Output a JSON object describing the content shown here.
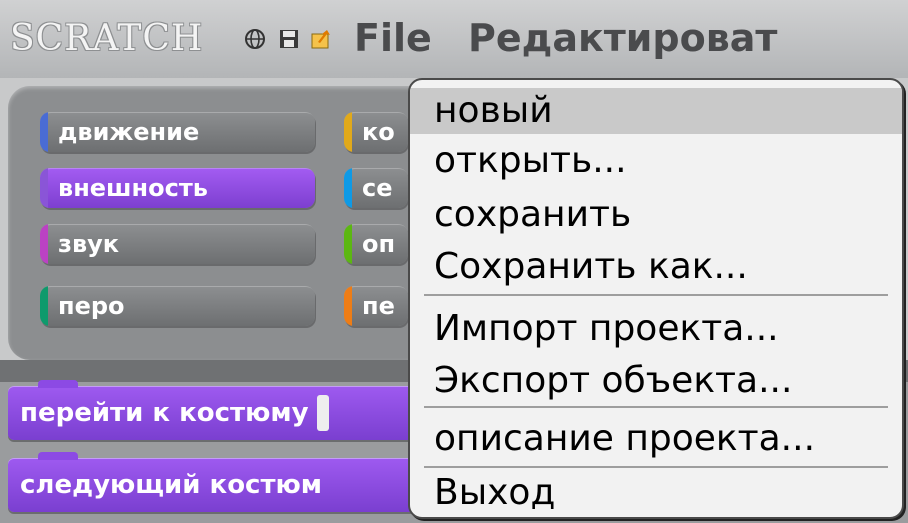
{
  "app": {
    "logo_text": "SCRATCH"
  },
  "topbar": {
    "icons": [
      "globe-icon",
      "save-disk-icon",
      "share-arrow-icon"
    ],
    "menus": [
      {
        "label": "File"
      },
      {
        "label": "Редактироват"
      }
    ]
  },
  "palette": {
    "categories": [
      {
        "label": "движение",
        "color": "#4a6cd4"
      },
      {
        "label": "ко",
        "color": "#e1a91a"
      },
      {
        "label": "внешность",
        "color": "#8a55d7",
        "selected": true
      },
      {
        "label": "се",
        "color": "#0e9ae6"
      },
      {
        "label": "звук",
        "color": "#bb42c3"
      },
      {
        "label": "оп",
        "color": "#5cb712"
      },
      {
        "label": "перо",
        "color": "#0e9a6c"
      },
      {
        "label": "пе",
        "color": "#ee7d16"
      }
    ]
  },
  "blocks": [
    {
      "label": "перейти к костюму"
    },
    {
      "label": "следующий костюм"
    }
  ],
  "file_menu": {
    "items": [
      {
        "label": "новый",
        "highlighted": true
      },
      {
        "label": "открыть..."
      },
      {
        "label": "сохранить"
      },
      {
        "label": "Сохранить как..."
      },
      {
        "label": "Импорт проекта..."
      },
      {
        "label": "Экспорт объекта..."
      },
      {
        "label": "описание проекта..."
      },
      {
        "label": "Выход"
      }
    ]
  }
}
